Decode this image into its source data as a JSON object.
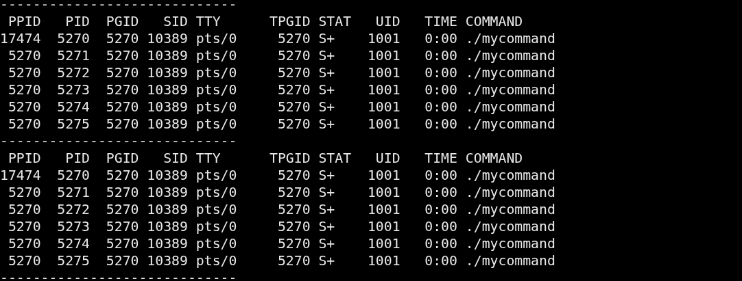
{
  "terminal": {
    "lines": [
      "-----------------------------",
      " PPID   PID  PGID   SID TTY      TPGID STAT   UID   TIME COMMAND",
      "17474  5270  5270 10389 pts/0     5270 S+    1001   0:00 ./mycommand",
      " 5270  5271  5270 10389 pts/0     5270 S+    1001   0:00 ./mycommand",
      " 5270  5272  5270 10389 pts/0     5270 S+    1001   0:00 ./mycommand",
      " 5270  5273  5270 10389 pts/0     5270 S+    1001   0:00 ./mycommand",
      " 5270  5274  5270 10389 pts/0     5270 S+    1001   0:00 ./mycommand",
      " 5270  5275  5270 10389 pts/0     5270 S+    1001   0:00 ./mycommand",
      "-----------------------------",
      " PPID   PID  PGID   SID TTY      TPGID STAT   UID   TIME COMMAND",
      "17474  5270  5270 10389 pts/0     5270 S+    1001   0:00 ./mycommand",
      " 5270  5271  5270 10389 pts/0     5270 S+    1001   0:00 ./mycommand",
      " 5270  5272  5270 10389 pts/0     5270 S+    1001   0:00 ./mycommand",
      " 5270  5273  5270 10389 pts/0     5270 S+    1001   0:00 ./mycommand",
      " 5270  5274  5270 10389 pts/0     5270 S+    1001   0:00 ./mycommand",
      " 5270  5275  5270 10389 pts/0     5270 S+    1001   0:00 ./mycommand",
      "-----------------------------"
    ]
  }
}
